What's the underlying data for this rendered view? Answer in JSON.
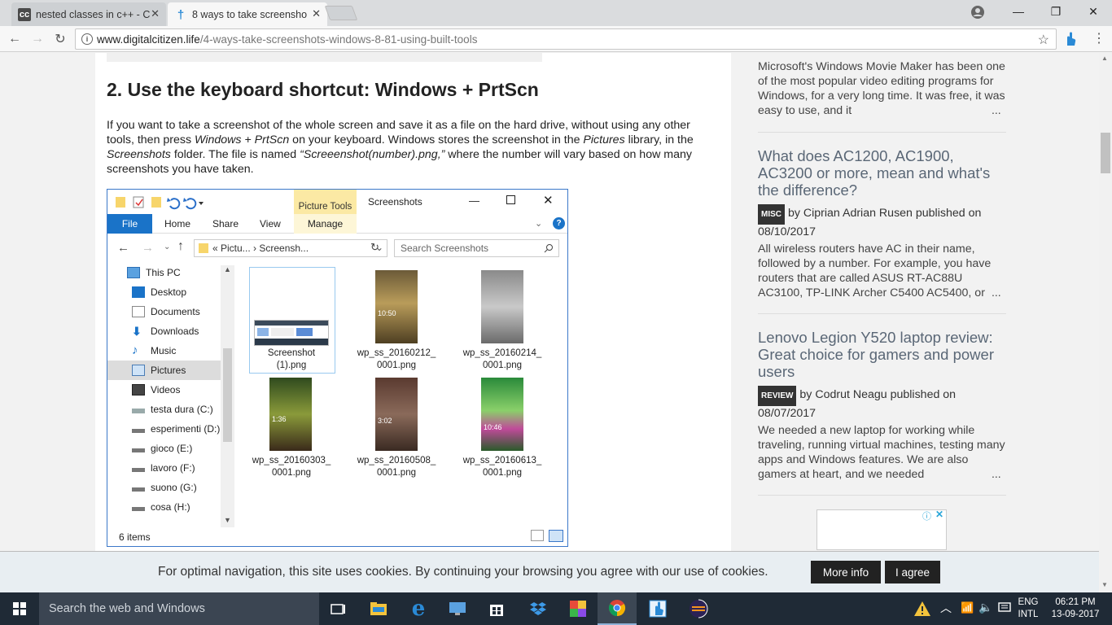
{
  "browser": {
    "tabs": [
      {
        "label": "nested classes in c++ - C",
        "favicon": "cc-icon",
        "favicon_text": "cc"
      },
      {
        "label": "8 ways to take screensho",
        "favicon": "dagger-icon",
        "favicon_text": "†"
      }
    ],
    "url_host": "www.digitalcitizen.life",
    "url_path": "/4-ways-take-screenshots-windows-8-81-using-built-tools"
  },
  "article": {
    "heading": "2. Use the keyboard shortcut: Windows + PrtScn",
    "para_1": "If you want to take a screenshot of the whole screen and save it as a file on the hard drive, without using any other tools, then press ",
    "para_em_1": "Windows + PrtScn",
    "para_2": " on your keyboard. Windows stores the screenshot in the ",
    "para_em_2": "Pictures",
    "para_3": " library, in the ",
    "para_em_3": "Screenshots",
    "para_4": " folder. The file is named ",
    "para_em_4": "“Screeenshot(number).png,”",
    "para_5": " where the number will vary based on how many screenshots you have taken."
  },
  "explorer": {
    "title": "Screenshots",
    "picture_tools": "Picture Tools",
    "ribbon_tabs": [
      "File",
      "Home",
      "Share",
      "View",
      "Manage"
    ],
    "address": "« Pictu... › Screensh...",
    "search_placeholder": "Search Screenshots",
    "nav_items": [
      "This PC",
      "Desktop",
      "Documents",
      "Downloads",
      "Music",
      "Pictures",
      "Videos",
      "testa dura (C:)",
      "esperimenti (D:)",
      "gioco (E:)",
      "lavoro (F:)",
      "suono (G:)",
      "cosa (H:)"
    ],
    "files": [
      {
        "line1": "Screenshot",
        "line2": "(1).png"
      },
      {
        "line1": "wp_ss_20160212_",
        "line2": "0001.png"
      },
      {
        "line1": "wp_ss_20160214_",
        "line2": "0001.png"
      },
      {
        "line1": "wp_ss_20160303_",
        "line2": "0001.png"
      },
      {
        "line1": "wp_ss_20160508_",
        "line2": "0001.png"
      },
      {
        "line1": "wp_ss_20160613_",
        "line2": "0001.png"
      }
    ],
    "thumb_times": [
      "10:50",
      "1:36",
      "3:02",
      "10:46"
    ],
    "status": "6 items"
  },
  "sidebar": {
    "intro_text": "Microsoft's Windows Movie Maker has been one of the most popular video editing programs for Windows, for a very long time. It was free, it was easy to use, and it",
    "ellipsis": "...",
    "posts": [
      {
        "title": "What does AC1200, AC1900, AC3200 or more, mean and what's the difference?",
        "badge": "MISC",
        "byline": "by Ciprian Adrian Rusen published on",
        "date": "08/10/2017",
        "excerpt": "All wireless routers have AC in their name, followed by a number. For example, you have routers that are called ASUS RT-AC88U AC3100, TP-LINK Archer C5400 AC5400, or"
      },
      {
        "title": "Lenovo Legion Y520 laptop review: Great choice for gamers and power users",
        "badge": "REVIEW",
        "byline": "by Codrut Neagu published on",
        "date": "08/07/2017",
        "excerpt": "We needed a new laptop for working while traveling, running virtual machines, testing many apps and Windows features. We are also gamers at heart, and we needed"
      }
    ]
  },
  "cookie": {
    "text": "For optimal navigation, this site uses cookies. By continuing your browsing you agree with our use of cookies.",
    "more_info": "More info",
    "agree": "I agree"
  },
  "taskbar": {
    "search_placeholder": "Search the web and Windows",
    "lang_1": "ENG",
    "lang_2": "INTL",
    "time": "06:21 PM",
    "date": "13-09-2017"
  },
  "colors": {
    "chrome_tab_bg": "#dadcde",
    "taskbar": "#1f2a36",
    "explorer_file_tab": "#1a73c8",
    "sidebar_title": "#5a6776"
  }
}
